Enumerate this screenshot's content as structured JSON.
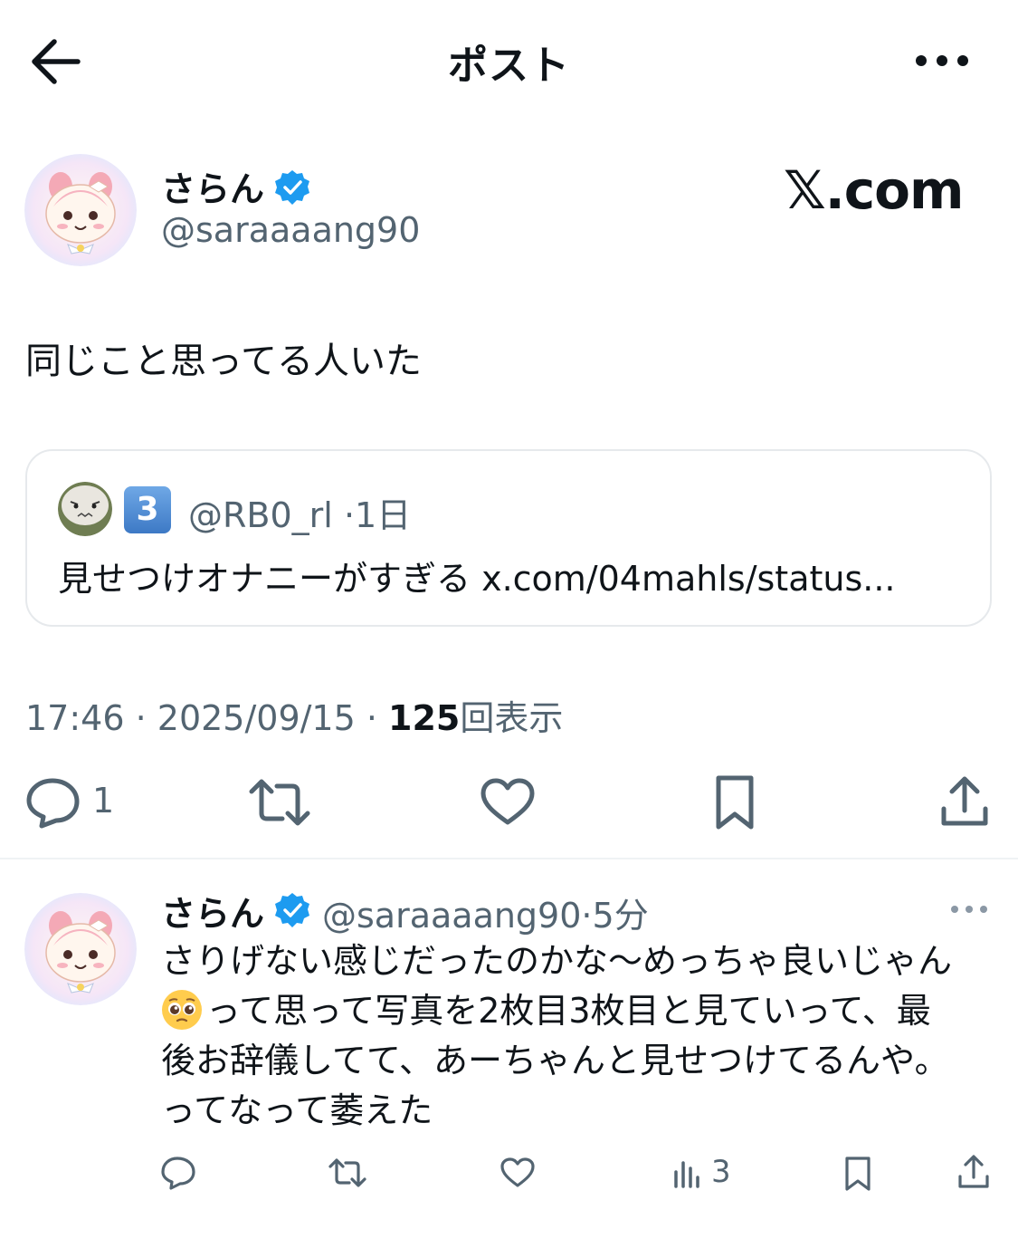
{
  "header": {
    "title": "ポスト",
    "back_icon": "arrow-left-icon",
    "more_icon": "ellipsis-icon"
  },
  "post": {
    "author": {
      "display_name": "さらん",
      "handle": "@saraaaang90",
      "verified": true
    },
    "watermark": "𝕏.com",
    "text": "同じこと思ってる人いた",
    "quoted": {
      "badge": "3",
      "handle": "@RB0_rl",
      "separator": "·",
      "time": "1日",
      "text": "見せつけオナニーがすぎる x.com/04mahls/status..."
    },
    "time": "17:46",
    "date": "2025/09/15",
    "views_count": "125",
    "views_label": "回表示",
    "actions": {
      "reply_count": "1"
    }
  },
  "reply": {
    "display_name": "さらん",
    "handle": "@saraaaang90",
    "separator": "·",
    "time": "5分",
    "text_line1": "さりげない感じだったのかな〜めっちゃ良いじゃん",
    "text_line2_after_emoji": "って思って写真を2枚目3枚目と見ていって、最",
    "text_line3": "後お辞儀してて、あーちゃんと見せつけてるんや。",
    "text_line4": "ってなって萎えた",
    "views": "3"
  },
  "colors": {
    "text": "#0f1419",
    "secondary": "#536471",
    "verified": "#1d9bf0",
    "border": "#e6e9ec"
  }
}
